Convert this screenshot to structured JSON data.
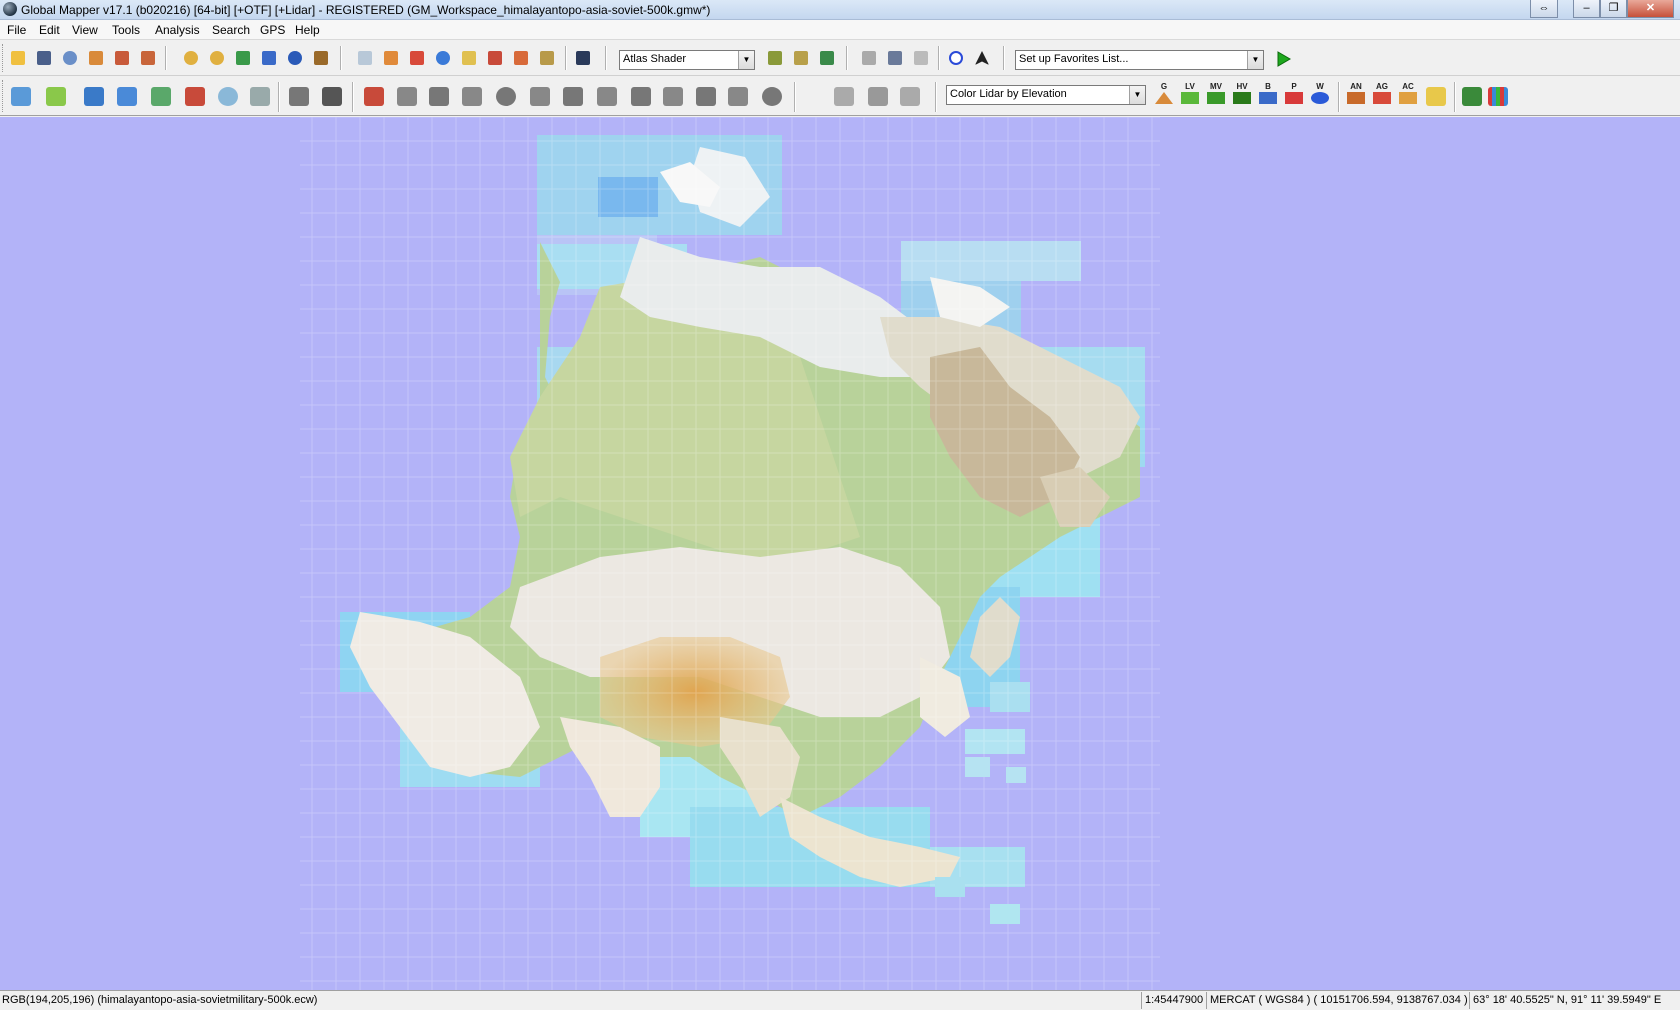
{
  "window": {
    "title": "Global Mapper v17.1 (b020216) [64-bit] [+OTF] [+Lidar] - REGISTERED (GM_Workspace_himalayantopo-asia-soviet-500k.gmw*)",
    "controls": [
      "⇔",
      "–",
      "❐",
      "✕"
    ]
  },
  "menu": [
    "File",
    "Edit",
    "View",
    "Tools",
    "Analysis",
    "Search",
    "GPS",
    "Help"
  ],
  "toolbar1": {
    "shader_combo": "Atlas Shader",
    "favorites_combo": "Set up Favorites List..."
  },
  "toolbar2": {
    "lidar_combo": "Color Lidar by Elevation",
    "lidar_buttons": [
      "G",
      "LV",
      "MV",
      "HV",
      "B",
      "P",
      "W",
      "AN",
      "AG",
      "AC"
    ]
  },
  "status": {
    "pixel_info": "RGB(194,205,196) (himalayantopo-asia-sovietmilitary-500k.ecw)",
    "scale": "1:45447900",
    "projection": "MERCAT ( WGS84 ) ( 10151706.594, 9138767.034 )",
    "coordinates": "63° 18' 40.5525\" N, 91° 11' 39.5949\" E"
  },
  "colors": {
    "map_background": "#b3b3f8",
    "water_tile": "#8fd0f0",
    "land_green": "#b9d49a",
    "land_white": "#ece8e0",
    "plateau_orange": "#e0b060"
  }
}
